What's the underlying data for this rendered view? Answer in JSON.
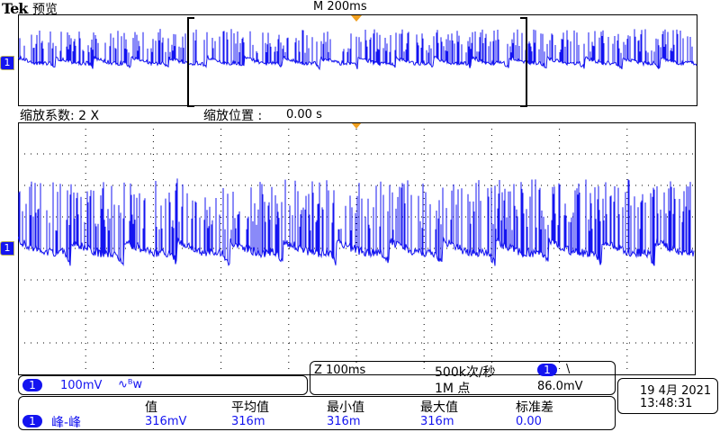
{
  "header": {
    "brand": "Tek",
    "mode": "预览",
    "timebase": "M 200ms"
  },
  "zoom": {
    "factor": "缩放系数: 2 X",
    "position_label": "缩放位置 :",
    "position_value": "0.00 s"
  },
  "channel": {
    "number": "1",
    "scale": "100mV",
    "coupling": "∿ᴮw"
  },
  "acq": {
    "zoom_timebase": "Z 100ms",
    "sample_rate": "500k次/秒",
    "record_length": "1M 点",
    "trigger_channel": "1",
    "trigger_slope": "\\",
    "trigger_level": "86.0mV"
  },
  "datetime": {
    "date": "19 4月 2021",
    "time": "13:48:31"
  },
  "measurements": {
    "headers": [
      "值",
      "平均值",
      "最小值",
      "最大值",
      "标准差"
    ],
    "row": {
      "channel": "1",
      "name": "峰-峰",
      "values": [
        "316mV",
        "316m",
        "316m",
        "316m",
        "0.00"
      ]
    }
  },
  "colors": {
    "trace": "#1414f0",
    "trigger": "#f0a020"
  }
}
